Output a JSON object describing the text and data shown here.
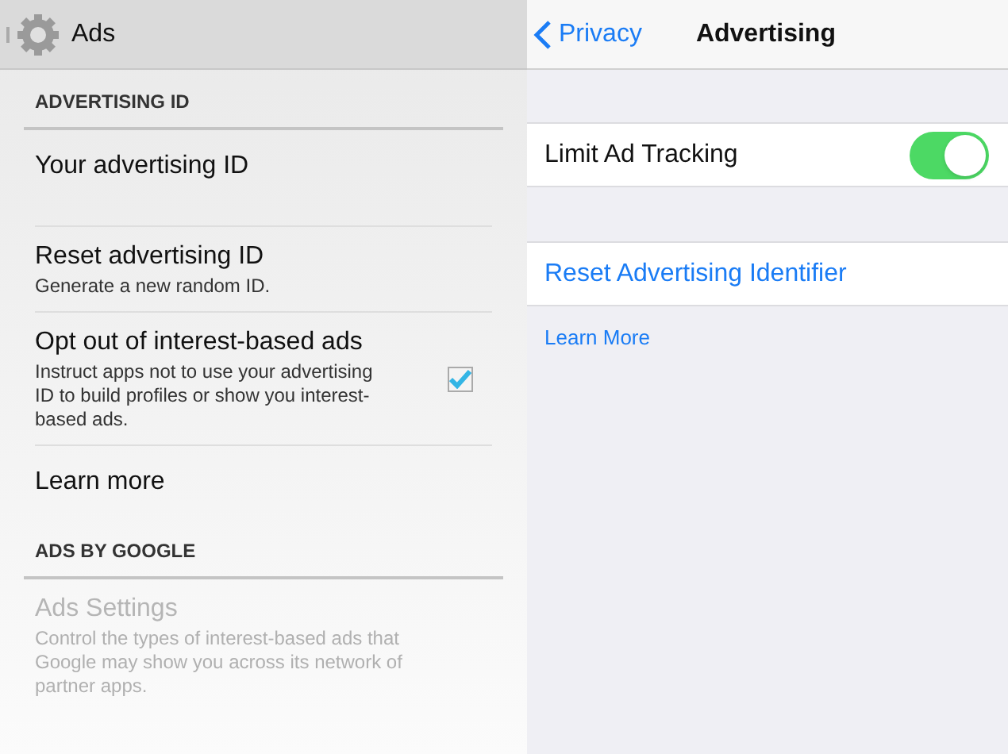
{
  "android": {
    "header": {
      "title": "Ads"
    },
    "sections": [
      {
        "title": "ADVERTISING ID",
        "items": [
          {
            "kind": "plain",
            "title": "Your advertising ID",
            "disabled": false
          },
          {
            "kind": "plain",
            "title": "Reset advertising ID",
            "subtitle": "Generate a new random ID.",
            "disabled": false
          },
          {
            "kind": "checkbox",
            "title": "Opt out of interest-based ads",
            "subtitle": "Instruct apps not to use your advertising ID to build profiles or show you interest-based ads.",
            "checked": true,
            "disabled": false
          },
          {
            "kind": "plain",
            "title": "Learn more",
            "disabled": false
          }
        ]
      },
      {
        "title": "ADS BY GOOGLE",
        "items": [
          {
            "kind": "plain",
            "title": "Ads Settings",
            "subtitle": "Control the types of interest-based ads that Google may show you across its network of partner apps.",
            "disabled": true
          }
        ]
      }
    ]
  },
  "ios": {
    "nav": {
      "back": "Privacy",
      "title": "Advertising"
    },
    "toggle": {
      "label": "Limit Ad Tracking",
      "on": true
    },
    "reset_link": "Reset Advertising Identifier",
    "learn_more": "Learn More"
  }
}
